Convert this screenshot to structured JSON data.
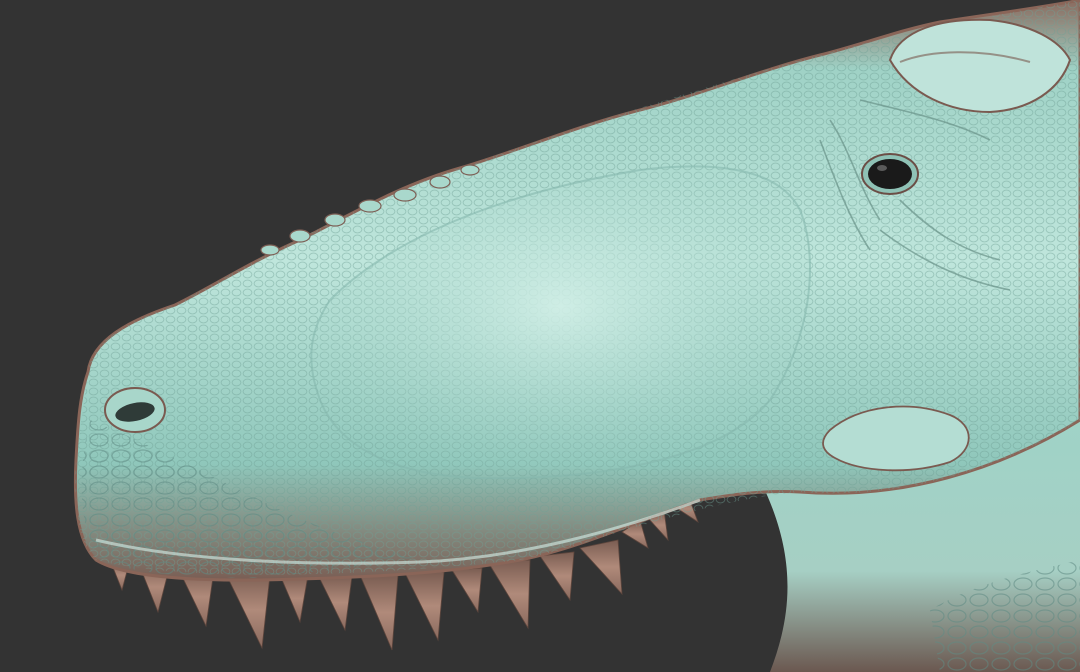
{
  "scene": {
    "subject": "dinosaur-head-sculpt",
    "icons": [
      "dinosaur-head-render"
    ],
    "colors": {
      "background": "#333333",
      "skin_highlight": "#bfe6dc",
      "skin_mid": "#8fc7bb",
      "skin_shadow": "#6f5a52",
      "rim_copper": "#a9735f",
      "teeth": "#a98272",
      "eye": "#1a1a1a"
    }
  }
}
